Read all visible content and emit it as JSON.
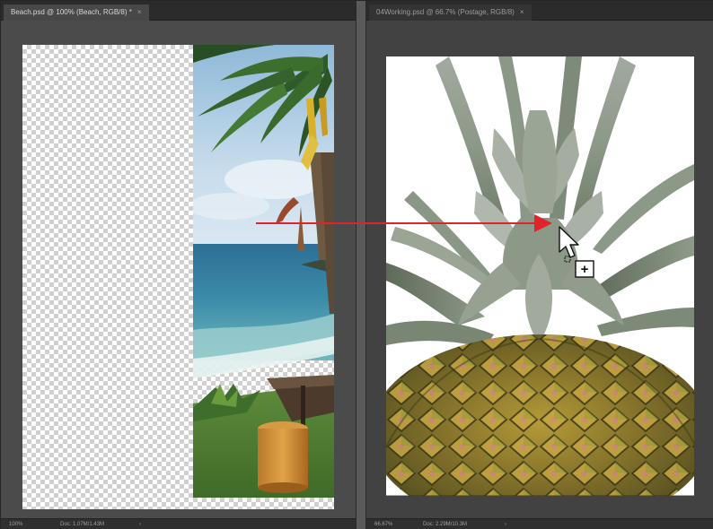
{
  "left_document": {
    "tab_title": "Beach.psd @ 100% (Beach, RGB/8) *",
    "close_glyph": "×",
    "status": {
      "zoom": "100%",
      "doc_info": "Doc: 1.07M/1.43M",
      "arrow": "›"
    }
  },
  "right_document": {
    "tab_title": "04Working.psd @ 66.7% (Postage, RGB/8)",
    "close_glyph": "×",
    "status": {
      "zoom": "66.67%",
      "doc_info": "Doc: 2.29M/10.3M",
      "arrow": "›"
    }
  },
  "drag": {
    "arrow_color": "#e0242b",
    "cursor_icon": "arrow-cursor-with-plus-icon",
    "badge_glyph": "+"
  }
}
